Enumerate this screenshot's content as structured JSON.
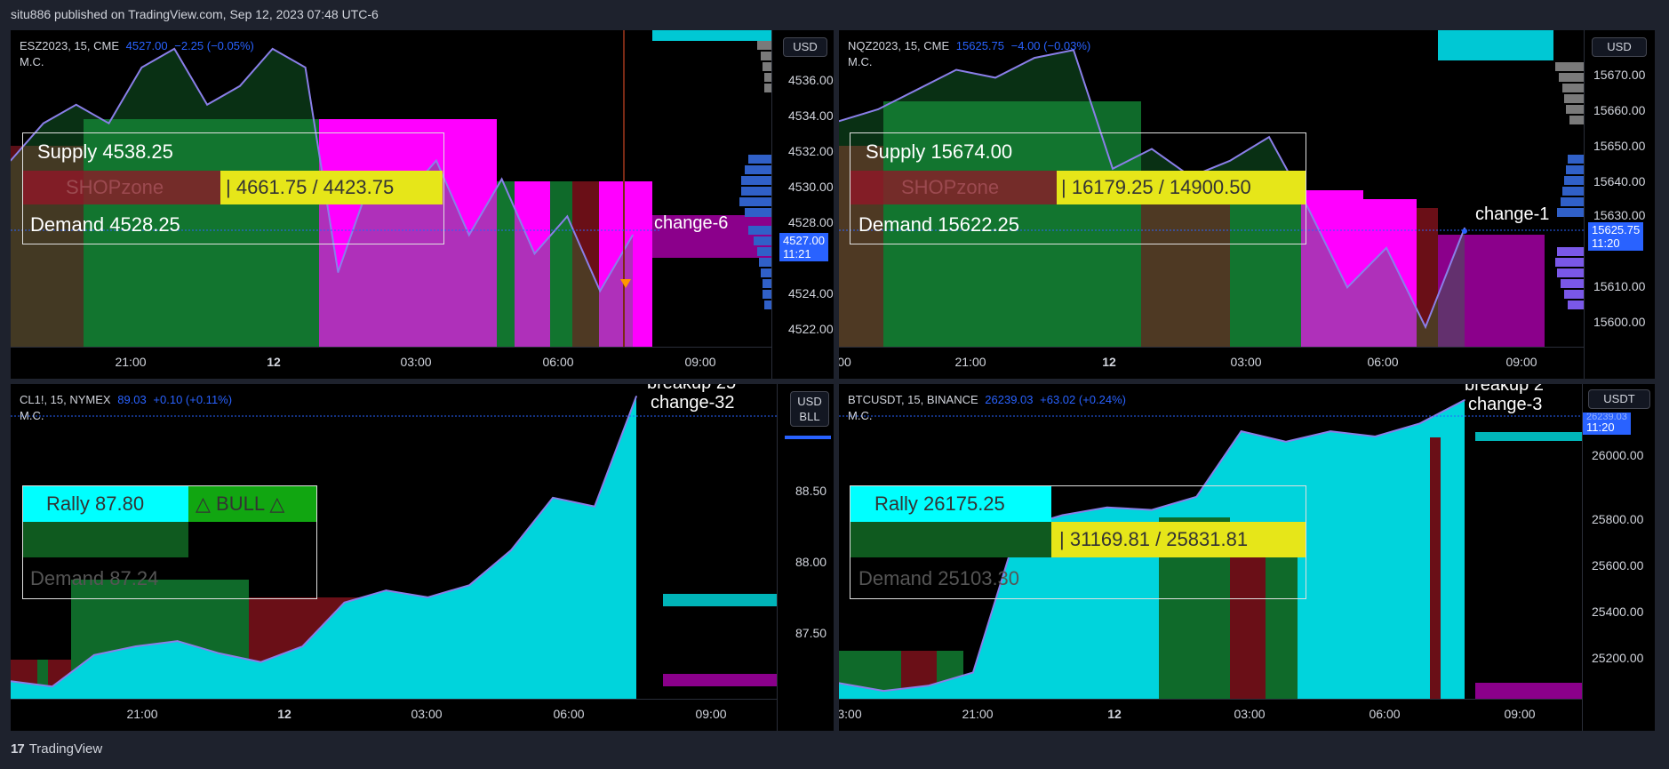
{
  "header": {
    "text": "situ886 published on TradingView.com, Sep 12, 2023 07:48 UTC-6"
  },
  "footer": {
    "logo": "17",
    "brand": "TradingView"
  },
  "colors": {
    "magenta": "#ff00ff",
    "cyan": "#00d4dc",
    "green": "#0f7a2a",
    "darkred": "#6a0f17",
    "yellow": "#e6e619",
    "accent": "#2962ff"
  },
  "panels": [
    {
      "title": "ESZ2023, 15, CME",
      "price": "4527.00",
      "change": "−2.25 (−0.05%)",
      "sub": "M.C.",
      "currency": "USD",
      "zone": {
        "top_label": "Supply  4538.25",
        "mid_label": "SHOPzone",
        "yellow_label": "|   4661.75  /  4423.75",
        "bottom_label": "Demand  4528.25"
      },
      "annotation": "change-6",
      "last_tag": {
        "price": "4527.00",
        "time": "11:21"
      },
      "y_ticks": [
        "4536.00",
        "4534.00",
        "4532.00",
        "4530.00",
        "4528.00",
        "4524.00",
        "4522.00"
      ],
      "x_ticks": [
        "21:00",
        "12",
        "03:00",
        "06:00",
        "09:00"
      ]
    },
    {
      "title": "NQZ2023, 15, CME",
      "price": "15625.75",
      "change": "−4.00 (−0.03%)",
      "sub": "M.C.",
      "currency": "USD",
      "zone": {
        "top_label": "Supply  15674.00",
        "mid_label": "SHOPzone",
        "yellow_label": "|   16179.25  /  14900.50",
        "bottom_label": "Demand  15622.25"
      },
      "annotation": "change-1",
      "last_tag": {
        "price": "15625.75",
        "time": "11:20"
      },
      "y_ticks": [
        "15670.00",
        "15660.00",
        "15650.00",
        "15640.00",
        "15630.00",
        "15610.00",
        "15600.00"
      ],
      "x_ticks": [
        "00",
        "21:00",
        "12",
        "03:00",
        "06:00",
        "09:00"
      ]
    },
    {
      "title": "CL1!, 15, NYMEX",
      "price": "89.03",
      "change": "+0.10 (+0.11%)",
      "sub": "M.C.",
      "currency": "USD",
      "currency2": "BLL",
      "zone": {
        "top_label": "Rally  87.80",
        "bull_label": "△ BULL △",
        "bottom_label": "Demand  87.24"
      },
      "annotation_top": "breakup 25",
      "annotation": "change-32",
      "y_ticks": [
        "88.50",
        "88.00",
        "87.50"
      ],
      "x_ticks": [
        "21:00",
        "12",
        "03:00",
        "06:00",
        "09:00"
      ]
    },
    {
      "title": "BTCUSDT, 15, BINANCE",
      "price": "26239.03",
      "change": "+63.02 (+0.24%)",
      "sub": "M.C.",
      "currency": "USDT",
      "zone": {
        "top_label": "Rally  26175.25",
        "yellow_label": "|   31169.81  /  25831.81",
        "bottom_label": "Demand  25103.30"
      },
      "annotation_top": "breakup 2",
      "annotation": "change-3",
      "last_tag": {
        "price": "26239.03",
        "time": "11:20"
      },
      "y_ticks": [
        "26000.00",
        "25800.00",
        "25600.00",
        "25400.00",
        "25200.00"
      ],
      "x_ticks": [
        "3:00",
        "21:00",
        "12",
        "03:00",
        "06:00",
        "09:00"
      ]
    }
  ],
  "chart_data": [
    {
      "type": "area",
      "title": "ESZ2023, 15, CME",
      "x": [
        "21:00",
        "12",
        "03:00",
        "06:00",
        "09:00"
      ],
      "values": [
        4531,
        4533,
        4534,
        4533,
        4536,
        4537,
        4534,
        4535,
        4537,
        4536,
        4525,
        4530,
        4529,
        4531,
        4527,
        4530,
        4526,
        4528,
        4524,
        4527
      ],
      "ylim": [
        4521,
        4538
      ]
    },
    {
      "type": "area",
      "title": "NQZ2023, 15, CME",
      "x": [
        "21:00",
        "12",
        "03:00",
        "06:00",
        "09:00"
      ],
      "values": [
        15652,
        15655,
        15660,
        15665,
        15663,
        15668,
        15670,
        15640,
        15645,
        15638,
        15642,
        15648,
        15630,
        15610,
        15620,
        15600,
        15625
      ],
      "ylim": [
        15595,
        15675
      ]
    },
    {
      "type": "area",
      "title": "CL1!, 15, NYMEX",
      "x": [
        "21:00",
        "12",
        "03:00",
        "06:00",
        "09:00"
      ],
      "values": [
        87.4,
        87.37,
        87.55,
        87.6,
        87.63,
        87.56,
        87.51,
        87.6,
        87.85,
        87.92,
        87.88,
        87.95,
        88.15,
        88.45,
        88.4,
        89.03
      ],
      "ylim": [
        87.3,
        89.1
      ]
    },
    {
      "type": "area",
      "title": "BTCUSDT, 15, BINANCE",
      "x": [
        "21:00",
        "12",
        "03:00",
        "06:00",
        "09:00"
      ],
      "values": [
        25160,
        25130,
        25150,
        25200,
        25750,
        25800,
        25830,
        25820,
        25870,
        26120,
        26080,
        26120,
        26100,
        26150,
        26239
      ],
      "ylim": [
        25100,
        26300
      ]
    }
  ]
}
